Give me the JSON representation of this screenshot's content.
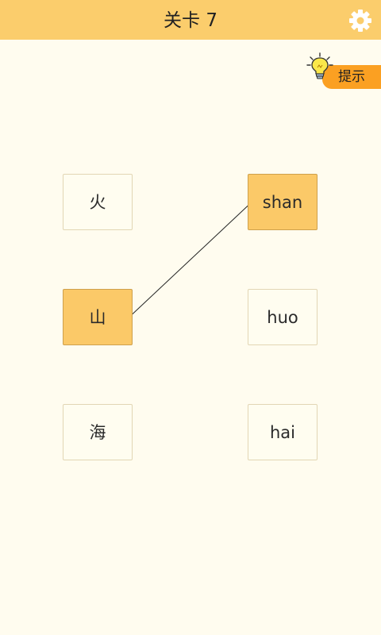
{
  "header": {
    "title": "关卡 7"
  },
  "hint": {
    "label": "提示"
  },
  "colors": {
    "header_bg": "#fbcd6c",
    "page_bg": "#fffcef",
    "tile_selected": "#fbc968",
    "hint_bg": "#fba022"
  },
  "board": {
    "left": [
      {
        "text": "火",
        "selected": false
      },
      {
        "text": "山",
        "selected": true
      },
      {
        "text": "海",
        "selected": false
      }
    ],
    "right": [
      {
        "text": "shan",
        "selected": true
      },
      {
        "text": "huo",
        "selected": false
      },
      {
        "text": "hai",
        "selected": false
      }
    ],
    "connections": [
      {
        "from_left": 1,
        "to_right": 0
      }
    ]
  }
}
